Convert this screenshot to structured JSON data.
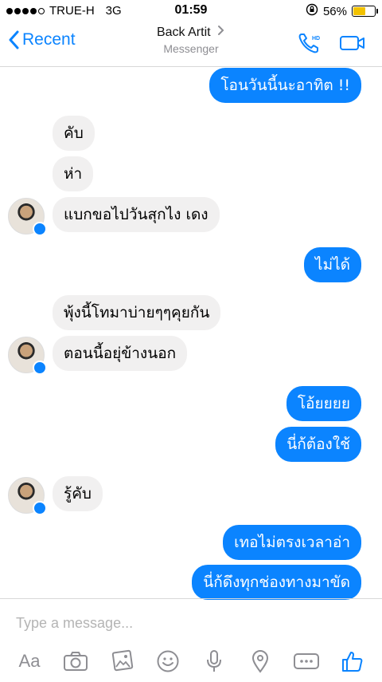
{
  "status_bar": {
    "carrier": "TRUE-H",
    "network": "3G",
    "time": "01:59",
    "battery_percent": "56%",
    "battery_level": 0.56
  },
  "nav": {
    "back_label": "Recent",
    "contact_name": "Back Artit",
    "subtitle": "Messenger",
    "hd_label": "HD"
  },
  "messages": {
    "m1": "โอนวันนี้นะอาทิต !!",
    "m2": "คับ",
    "m3": "ห่า",
    "m4": "แบกขอไปวันสุกไง เดง",
    "m5": "ไม่ได้",
    "m6": "พุ้งนี้โทมาบ่ายๆๆคุยกัน",
    "m7": "ตอนนี้อยุ่ข้างนอก",
    "m8": "โอ้ยยยย",
    "m9": "นี่ก้ต้องใช้",
    "m10": "รู้คับ",
    "m11": "เทอไม่ตรงเวลาอ่า",
    "m12": "นี่ก้ดึงทุกช่องทางมาขัด"
  },
  "composer": {
    "placeholder": "Type a message...",
    "aa_label": "Aa",
    "more_label": "ooo"
  },
  "colors": {
    "accent": "#0b84ff",
    "incoming_bubble": "#f1f0f0",
    "battery": "#f2c200"
  },
  "icons": [
    "signal-dots-icon",
    "rotation-lock-icon",
    "battery-icon",
    "chevron-left-icon",
    "chevron-right-icon",
    "phone-hd-icon",
    "video-call-icon",
    "messenger-badge-icon",
    "camera-icon",
    "gallery-icon",
    "emoji-icon",
    "microphone-icon",
    "location-icon",
    "more-icon",
    "thumbs-up-icon"
  ]
}
